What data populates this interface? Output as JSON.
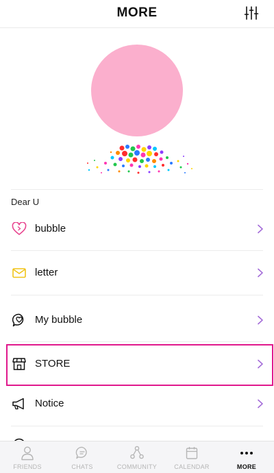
{
  "header": {
    "title": "MORE"
  },
  "greeting": "Dear U",
  "menu": [
    {
      "label": "bubble"
    },
    {
      "label": "letter"
    },
    {
      "label": "My bubble"
    },
    {
      "label": "STORE"
    },
    {
      "label": "Notice"
    }
  ],
  "tabs": [
    {
      "label": "FRIENDS",
      "icon": "person-icon"
    },
    {
      "label": "CHATS",
      "icon": "chat-bubble-icon"
    },
    {
      "label": "COMMUNITY",
      "icon": "share-network-icon"
    },
    {
      "label": "CALENDAR",
      "icon": "calendar-icon"
    },
    {
      "label": "MORE",
      "icon": "more-dots-icon"
    }
  ],
  "colors": {
    "accent": "#a36bd8",
    "avatar": "#fbafcd",
    "highlight": "#e0188c",
    "heart": "#e8458f",
    "envelope": "#f0c419"
  }
}
